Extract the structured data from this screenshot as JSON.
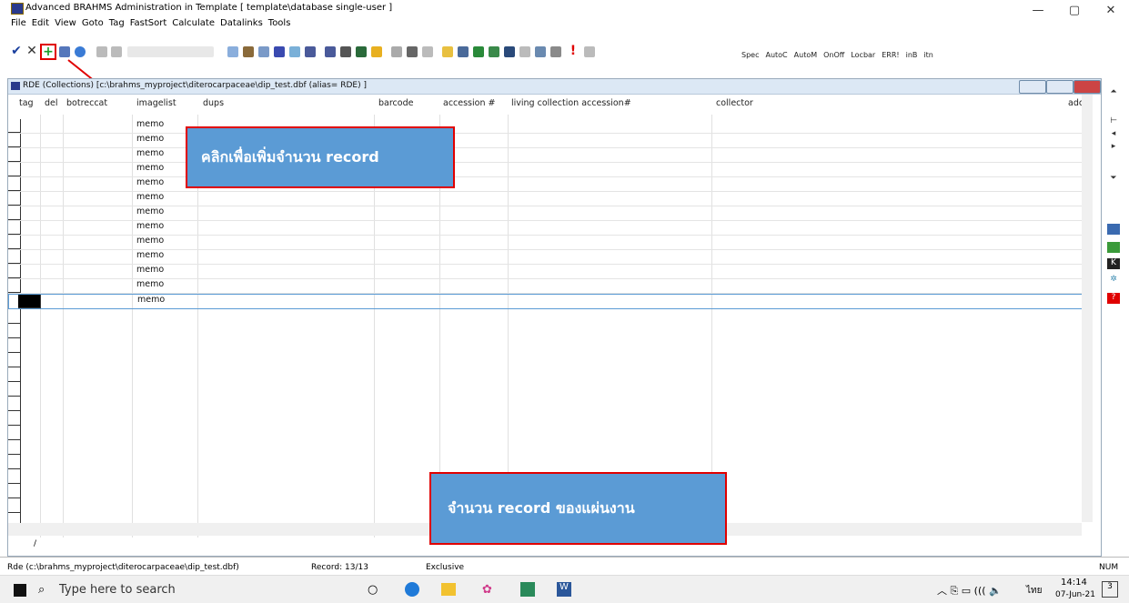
{
  "window": {
    "title": "Advanced BRAHMS   Administration in Template [ template\\database  single-user ]",
    "controls": [
      "—",
      "▢",
      "✕"
    ]
  },
  "menu": [
    "File",
    "Edit",
    "View",
    "Goto",
    "Tag",
    "FastSort",
    "Calculate",
    "Datalinks",
    "Tools"
  ],
  "toolbar_text": [
    "Spec",
    "AutoC",
    "AutoM",
    "OnOff",
    "Locbar",
    "ERR!",
    "inB",
    "itn"
  ],
  "rde": {
    "title": "RDE (Collections) [c:\\brahms_myproject\\diterocarpaceae\\dip_test.dbf (alias= RDE) ]",
    "columns": [
      "tag",
      "del",
      "botreccat",
      "imagelist",
      "dups",
      "barcode",
      "accession #",
      "living collection accession#",
      "collector",
      "adc"
    ],
    "rows": [
      "memo",
      "memo",
      "memo",
      "memo",
      "memo",
      "memo",
      "memo",
      "memo",
      "memo",
      "memo",
      "memo",
      "memo",
      "memo"
    ],
    "bottom_label": "/"
  },
  "callouts": {
    "add_record": "คลิกเพื่อเพิ่มจำนวน record",
    "record_count": "จำนวน record ของแผ่นงาน"
  },
  "status": {
    "path": "Rde (c:\\brahms_myproject\\diterocarpaceae\\dip_test.dbf)",
    "record": "Record: 13/13",
    "mode": "Exclusive",
    "num": "NUM"
  },
  "taskbar": {
    "search_placeholder": "Type here to search",
    "time": "14:14",
    "date": "07-Jun-21",
    "lang": "ไทย",
    "notif_count": "3"
  },
  "colors": {
    "accent": "#5b9bd5",
    "highlight": "#e00000",
    "titlebar": "#dce8f5"
  }
}
